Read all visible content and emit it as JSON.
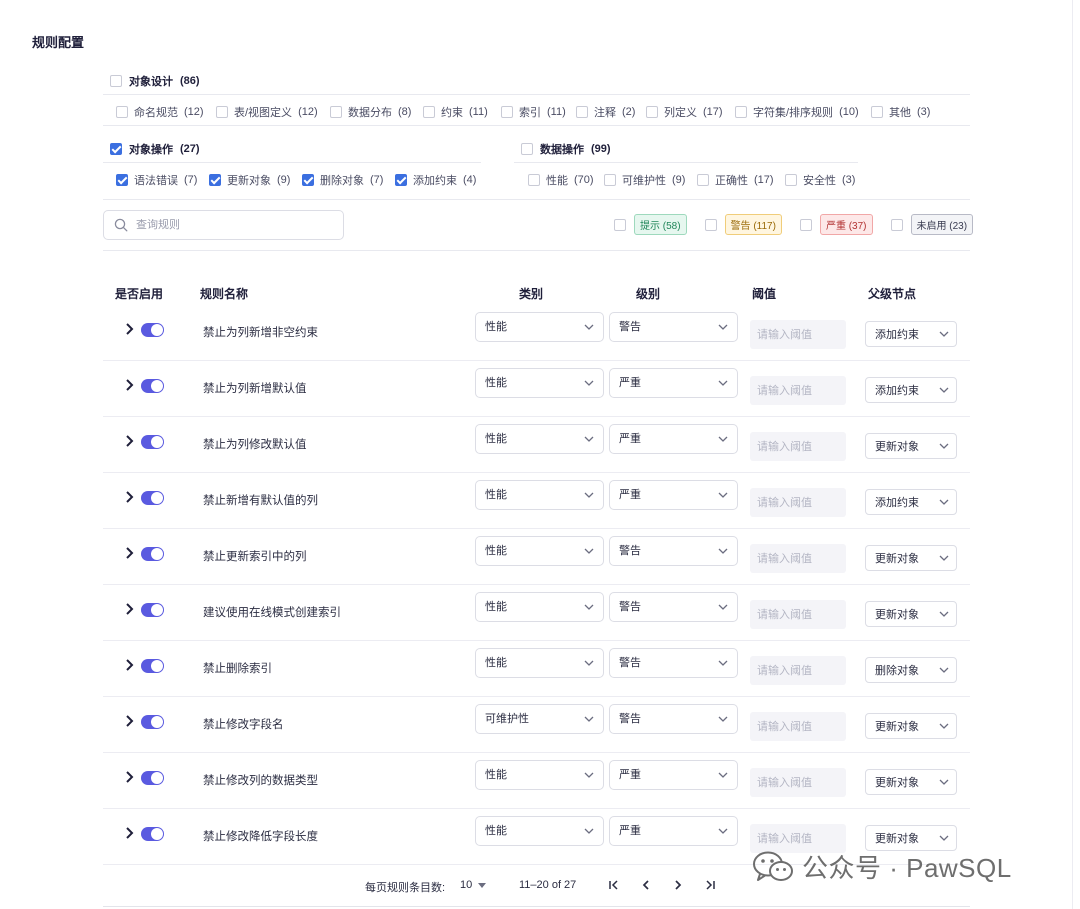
{
  "page_title": "规则配置",
  "groups": {
    "object_design": {
      "label": "对象设计",
      "count": "(86)",
      "checked": false,
      "items": [
        {
          "label": "命名规范",
          "count": "(12)"
        },
        {
          "label": "表/视图定义",
          "count": "(12)"
        },
        {
          "label": "数据分布",
          "count": "(8)"
        },
        {
          "label": "约束",
          "count": "(11)"
        },
        {
          "label": "索引",
          "count": "(11)"
        },
        {
          "label": "注释",
          "count": "(2)"
        },
        {
          "label": "列定义",
          "count": "(17)"
        },
        {
          "label": "字符集/排序规则",
          "count": "(10)"
        },
        {
          "label": "其他",
          "count": "(3)"
        }
      ]
    },
    "object_ops": {
      "label": "对象操作",
      "count": "(27)",
      "checked": true,
      "items": [
        {
          "label": "语法错误",
          "count": "(7)"
        },
        {
          "label": "更新对象",
          "count": "(9)"
        },
        {
          "label": "删除对象",
          "count": "(7)"
        },
        {
          "label": "添加约束",
          "count": "(4)"
        }
      ]
    },
    "data_ops": {
      "label": "数据操作",
      "count": "(99)",
      "checked": false,
      "items": [
        {
          "label": "性能",
          "count": "(70)"
        },
        {
          "label": "可维护性",
          "count": "(9)"
        },
        {
          "label": "正确性",
          "count": "(17)"
        },
        {
          "label": "安全性",
          "count": "(3)"
        }
      ]
    }
  },
  "search": {
    "placeholder": "查询规则"
  },
  "level_filters": [
    {
      "label": "提示 (58)"
    },
    {
      "label": "警告 (117)"
    },
    {
      "label": "严重 (37)"
    },
    {
      "label": "未启用 (23)"
    }
  ],
  "columns": {
    "enabled": "是否启用",
    "name": "规则名称",
    "category": "类别",
    "level": "级别",
    "threshold": "阈值",
    "parent": "父级节点"
  },
  "threshold_placeholder": "请输入阈值",
  "rules": [
    {
      "name": "禁止为列新增非空约束",
      "category": "性能",
      "level": "警告",
      "parent": "添加约束"
    },
    {
      "name": "禁止为列新增默认值",
      "category": "性能",
      "level": "严重",
      "parent": "添加约束"
    },
    {
      "name": "禁止为列修改默认值",
      "category": "性能",
      "level": "严重",
      "parent": "更新对象"
    },
    {
      "name": "禁止新增有默认值的列",
      "category": "性能",
      "level": "严重",
      "parent": "添加约束"
    },
    {
      "name": "禁止更新索引中的列",
      "category": "性能",
      "level": "警告",
      "parent": "更新对象"
    },
    {
      "name": "建议使用在线模式创建索引",
      "category": "性能",
      "level": "警告",
      "parent": "更新对象"
    },
    {
      "name": "禁止删除索引",
      "category": "性能",
      "level": "警告",
      "parent": "删除对象"
    },
    {
      "name": "禁止修改字段名",
      "category": "可维护性",
      "level": "警告",
      "parent": "更新对象"
    },
    {
      "name": "禁止修改列的数据类型",
      "category": "性能",
      "level": "严重",
      "parent": "更新对象"
    },
    {
      "name": "禁止修改降低字段长度",
      "category": "性能",
      "level": "严重",
      "parent": "更新对象"
    }
  ],
  "pagination": {
    "per_page_label": "每页规则条目数:",
    "per_page": "10",
    "range": "11–20 of 27"
  },
  "watermark": {
    "text": "公众号 · PawSQL"
  }
}
